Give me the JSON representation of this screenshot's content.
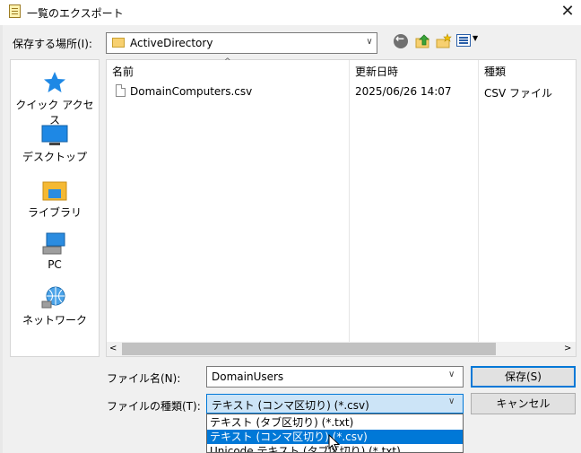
{
  "window": {
    "title": "一覧のエクスポート",
    "close_glyph": "✕"
  },
  "save_location": {
    "label": "保存する場所(I):",
    "value": "ActiveDirectory"
  },
  "toolbar": {
    "icons": [
      "back-icon",
      "up-folder-icon",
      "new-folder-icon",
      "view-menu-icon"
    ]
  },
  "places": [
    {
      "label": "クイック アクセス",
      "icon": "star-icon"
    },
    {
      "label": "デスクトップ",
      "icon": "desktop-icon"
    },
    {
      "label": "ライブラリ",
      "icon": "library-icon"
    },
    {
      "label": "PC",
      "icon": "pc-icon"
    },
    {
      "label": "ネットワーク",
      "icon": "network-icon"
    }
  ],
  "file_list": {
    "columns": [
      "名前",
      "更新日時",
      "種類"
    ],
    "rows": [
      {
        "name": "DomainComputers.csv",
        "modified": "2025/06/26 14:07",
        "type": "CSV ファイル"
      }
    ]
  },
  "filename": {
    "label": "ファイル名(N):",
    "value": "DomainUsers"
  },
  "filetype": {
    "label": "ファイルの種類(T):",
    "value": "テキスト (コンマ区切り) (*.csv)",
    "options": [
      "テキスト (タブ区切り) (*.txt)",
      "テキスト (コンマ区切り) (*.csv)",
      "Unicode テキスト (タブ区切り) (*.txt)"
    ],
    "selected_index": 1
  },
  "buttons": {
    "save": "保存(S)",
    "cancel": "キャンセル"
  },
  "colors": {
    "accent": "#0078d7",
    "selection_bg": "#cce4f7"
  }
}
